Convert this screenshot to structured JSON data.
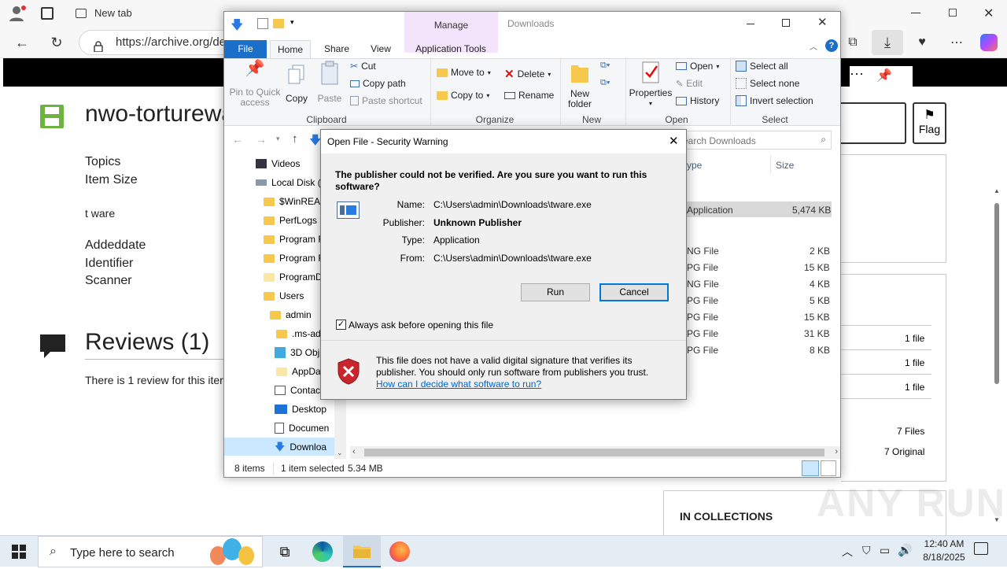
{
  "browser": {
    "tabs": [
      {
        "label": "New tab"
      }
    ],
    "url": "https://archive.org/de",
    "colors": {
      "chrome_bg": "#f7f7f7"
    }
  },
  "archive": {
    "item_title": "nwo-torturewa",
    "meta_labels": [
      "Topics",
      "Item Size"
    ],
    "topic_value": "t ware",
    "meta_labels2": [
      "Addeddate",
      "Identifier",
      "Scanner"
    ],
    "reviews_heading": "Reviews (1)",
    "reviews_text": "There is 1 review for this iter",
    "flag_label": "Flag",
    "file_counts": [
      "1 file",
      "1 file",
      "1 file"
    ],
    "files_total": "7 Files",
    "files_original": "7 Original",
    "collections_heading": "IN COLLECTIONS"
  },
  "explorer": {
    "title_tab_manage": "Manage",
    "title_location": "Downloads",
    "tabs": {
      "file": "File",
      "home": "Home",
      "share": "Share",
      "view": "View",
      "app_tools": "Application Tools"
    },
    "clipboard": {
      "pin": "Pin to Quick access",
      "copy": "Copy",
      "paste": "Paste",
      "cut": "Cut",
      "copy_path": "Copy path",
      "paste_shortcut": "Paste shortcut",
      "label": "Clipboard"
    },
    "organize": {
      "move_to": "Move to",
      "copy_to": "Copy to",
      "delete": "Delete",
      "rename": "Rename",
      "label": "Organize"
    },
    "new_group": {
      "new_folder": "New folder",
      "label": "New"
    },
    "open_group": {
      "properties": "Properties",
      "open": "Open",
      "edit": "Edit",
      "history": "History",
      "label": "Open"
    },
    "select_group": {
      "select_all": "Select all",
      "select_none": "Select none",
      "invert": "Invert selection",
      "label": "Select"
    },
    "search_placeholder": "earch Downloads",
    "columns": {
      "type": "ype",
      "size": "Size"
    },
    "tree": [
      {
        "label": "Videos"
      },
      {
        "label": "Local Disk (("
      },
      {
        "label": "$WinREAg"
      },
      {
        "label": "PerfLogs"
      },
      {
        "label": "Program F"
      },
      {
        "label": "Program F"
      },
      {
        "label": "ProgramD"
      },
      {
        "label": "Users"
      },
      {
        "label": "admin"
      },
      {
        "label": ".ms-ad"
      },
      {
        "label": "3D Obje"
      },
      {
        "label": "AppDat"
      },
      {
        "label": "Contac"
      },
      {
        "label": "Desktop"
      },
      {
        "label": "Documen"
      },
      {
        "label": "Downloa"
      }
    ],
    "rows": [
      {
        "type": "Application",
        "size": "5,474 KB"
      },
      {
        "type": "NG File",
        "size": "2 KB"
      },
      {
        "type": "PG File",
        "size": "15 KB"
      },
      {
        "type": "NG File",
        "size": "4 KB"
      },
      {
        "type": "PG File",
        "size": "5 KB"
      },
      {
        "type": "PG File",
        "size": "15 KB"
      },
      {
        "type": "PG File",
        "size": "31 KB"
      },
      {
        "type": "PG File",
        "size": "8 KB"
      }
    ],
    "status": {
      "items": "8 items",
      "selected": "1 item selected",
      "size": "5.34 MB"
    }
  },
  "dialog": {
    "title": "Open File - Security Warning",
    "question": "The publisher could not be verified.  Are you sure you want to run this software?",
    "fields": {
      "name_label": "Name:",
      "name_value": "C:\\Users\\admin\\Downloads\\tware.exe",
      "publisher_label": "Publisher:",
      "publisher_value": "Unknown Publisher",
      "type_label": "Type:",
      "type_value": "Application",
      "from_label": "From:",
      "from_value": "C:\\Users\\admin\\Downloads\\tware.exe"
    },
    "run_label": "Run",
    "cancel_label": "Cancel",
    "checkbox_label": "Always ask before opening this file",
    "checkbox_checked": true,
    "warning_text": "This file does not have a valid digital signature that verifies its publisher.  You should only run software from publishers you trust.",
    "help_link": "How can I decide what software to run?"
  },
  "taskbar": {
    "search_placeholder": "Type here to search",
    "time": "12:40 AM",
    "date": "8/18/2025"
  },
  "watermark": "ANY RUN"
}
